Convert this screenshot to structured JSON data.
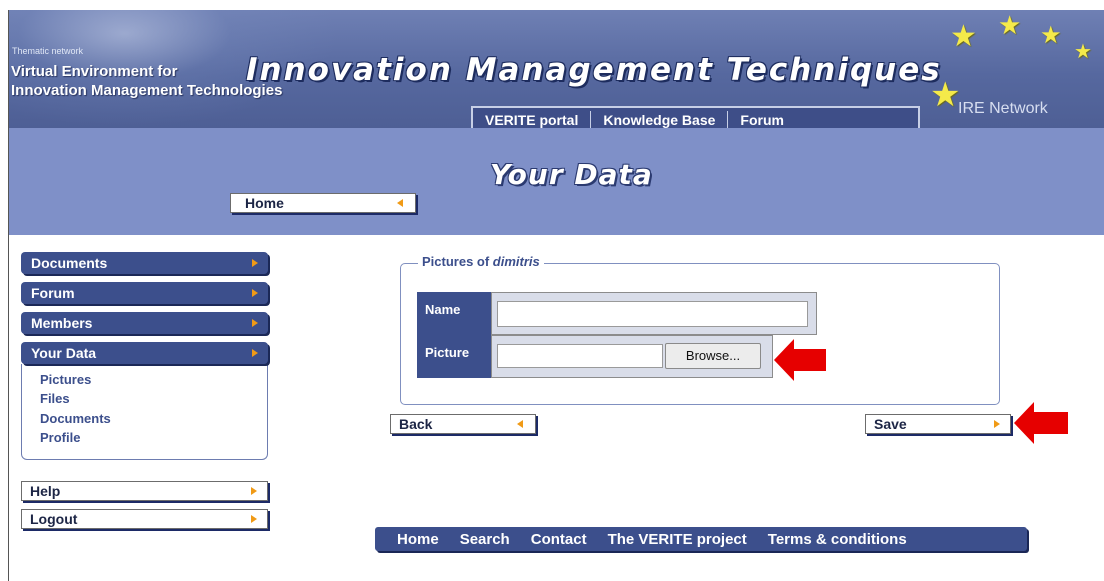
{
  "header": {
    "thematic": "Thematic network",
    "org_line1": "Virtual Environment for",
    "org_line2": "Innovation Management Technologies",
    "brand": "Innovation Management Techniques",
    "network": "IRE Network",
    "top_nav": [
      "VERITE portal",
      "Knowledge Base",
      "Forum"
    ]
  },
  "band": {
    "title": "Your Data",
    "home_button": "Home"
  },
  "sidebar": {
    "items": [
      "Documents",
      "Forum",
      "Members",
      "Your Data"
    ],
    "subitems": [
      "Pictures",
      "Files",
      "Documents",
      "Profile"
    ],
    "bottom": [
      "Help",
      "Logout"
    ]
  },
  "form": {
    "legend_prefix": "Pictures of ",
    "legend_user": "dimitris",
    "name_label": "Name",
    "name_value": "",
    "picture_label": "Picture",
    "picture_value": "",
    "browse_label": "Browse..."
  },
  "actions": {
    "back": "Back",
    "save": "Save"
  },
  "footer": {
    "links": [
      "Home",
      "Search",
      "Contact",
      "The VERITE project",
      "Terms & conditions"
    ]
  },
  "colors": {
    "header": "#56689f",
    "band": "#7f90c8",
    "nav": "#3c4f8c",
    "arrow": "#f09a16",
    "annotation": "#e60000"
  }
}
